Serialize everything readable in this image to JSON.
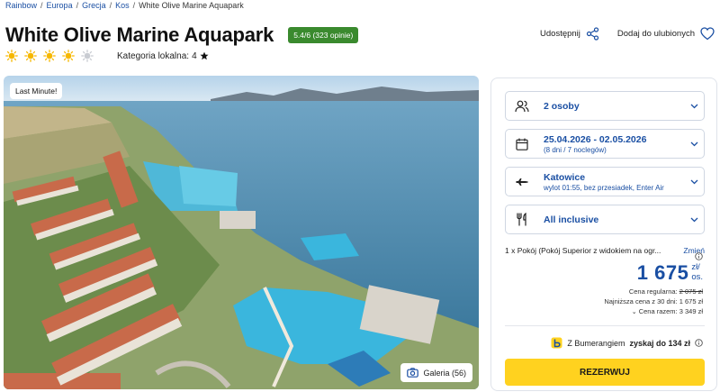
{
  "breadcrumb": {
    "items": [
      "Rainbow",
      "Europa",
      "Grecja",
      "Kos"
    ],
    "current": "White Olive Marine Aquapark",
    "separator": "/"
  },
  "hotel": {
    "title": "White Olive Marine Aquapark",
    "rating_badge": "5.4/6 (323 opinie)",
    "sun_rating": 4,
    "sun_max": 5,
    "local_category_label": "Kategoria lokalna:",
    "local_category_value": "4"
  },
  "actions": {
    "share_label": "Udostępnij",
    "favorite_label": "Dodaj do ulubionych"
  },
  "photo": {
    "badge": "Last Minute!",
    "gallery_label": "Galeria (56)"
  },
  "booking": {
    "persons": "2 osoby",
    "dates": "25.04.2026 - 02.05.2026",
    "dates_sub": "(8 dni / 7 noclegów)",
    "departure": "Katowice",
    "departure_sub": "wylot 01:55, bez przesiadek, Enter Air",
    "board": "All inclusive",
    "room_text": "1 x Pokój  (Pokój Superior z widokiem na ogr...",
    "room_change": "Zmień",
    "price": "1 675",
    "price_unit_1": "zł/",
    "price_unit_2": "os.",
    "regular_label": "Cena regularna:",
    "regular_value": "2 075 zł",
    "lowest_label": "Najniższa cena z 30 dni: 1 675 zł",
    "total_label": "Cena razem: 3 349 zł",
    "bumerang_prefix": "Z Bumerangiem",
    "bumerang_bold": "zyskaj do 134 zł",
    "reserve_label": "REZERWUJ"
  },
  "colors": {
    "brand_blue": "#1a4fa3",
    "rating_green": "#3a8a2e",
    "cta_yellow": "#ffd21f",
    "sun_yellow": "#f6b800"
  }
}
